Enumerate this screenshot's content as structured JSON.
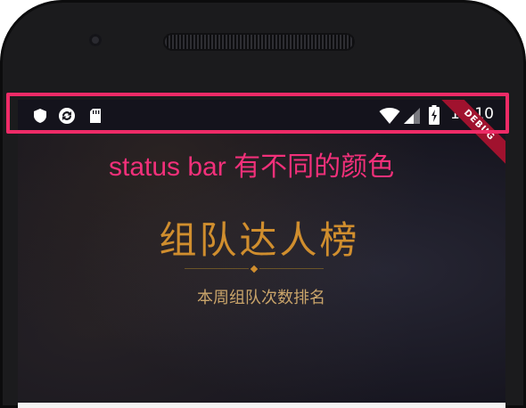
{
  "status_bar": {
    "left_icons": [
      "shield-icon",
      "sync-icon",
      "sd-card-icon"
    ],
    "right_icons": [
      "wifi-icon",
      "signal-icon",
      "battery-charging-icon"
    ],
    "time": "10:10",
    "debug_ribbon": "DEBUG"
  },
  "annotation": {
    "text": "status bar 有不同的颜色",
    "color": "#ee2b67"
  },
  "header": {
    "title": "组队达人榜",
    "subtitle": "本周组队次数排名",
    "accent_color": "#d08e2e"
  }
}
